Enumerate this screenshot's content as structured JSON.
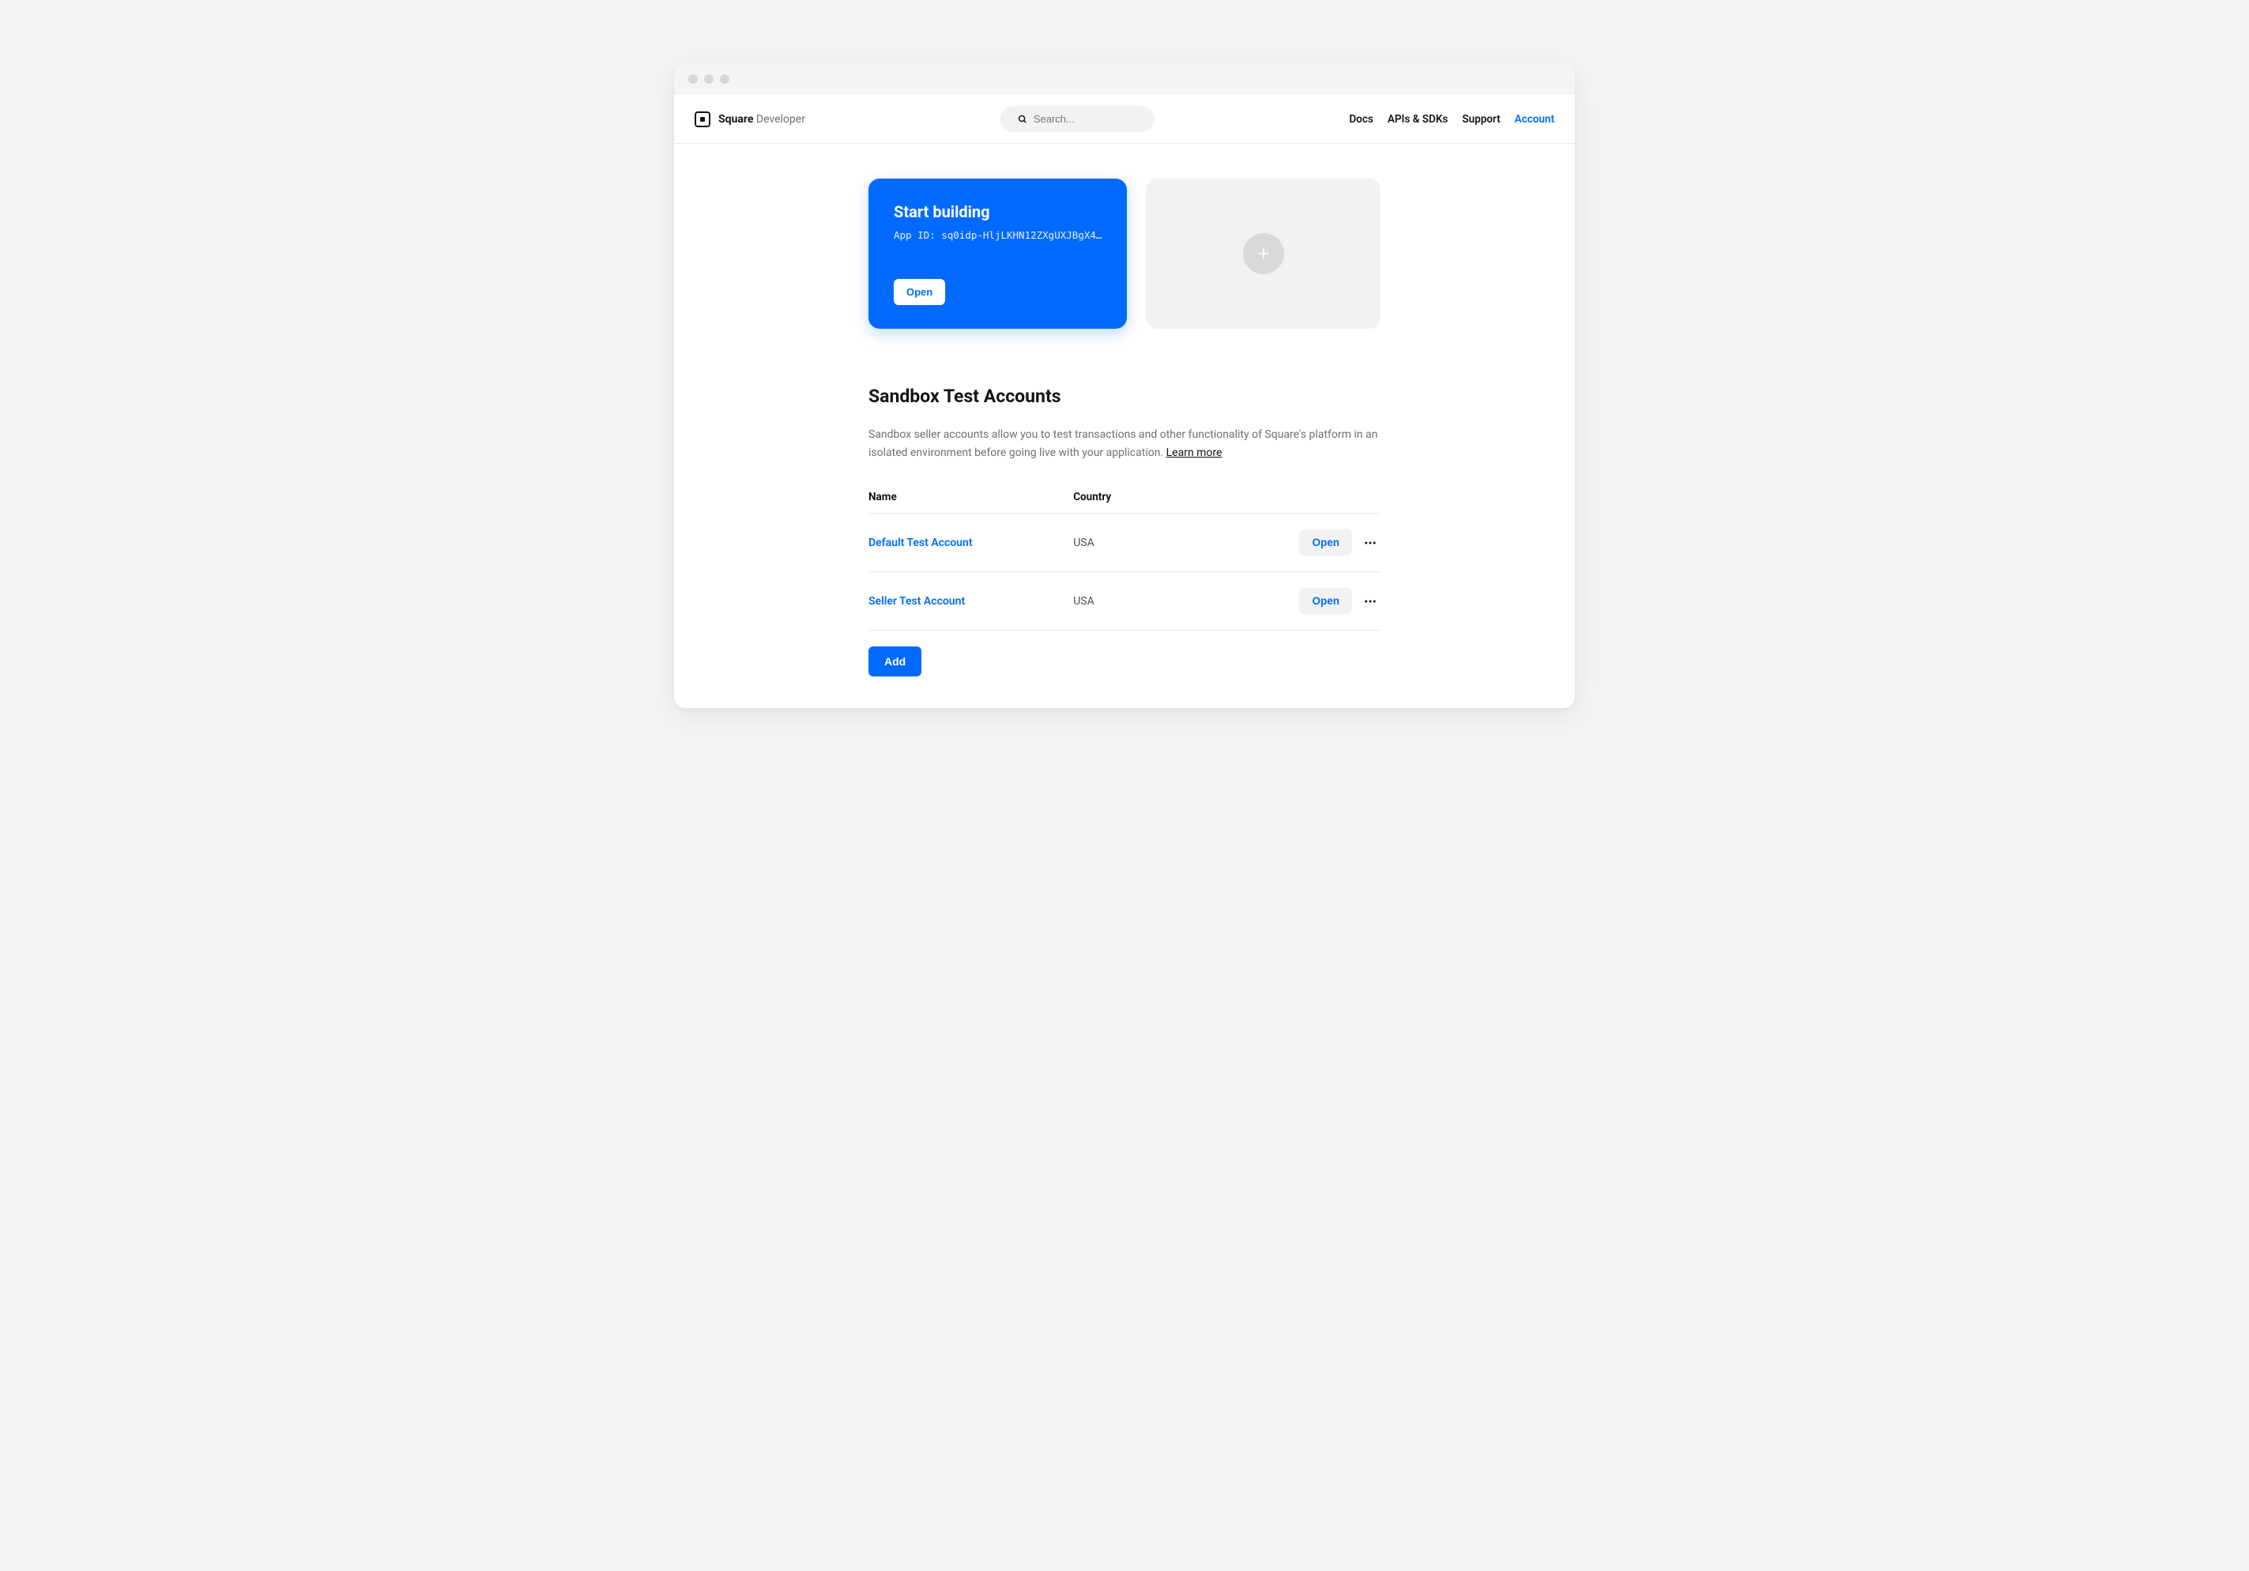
{
  "header": {
    "brand": "Square",
    "brand_sub": "Developer",
    "search_placeholder": "Search...",
    "nav": [
      {
        "label": "Docs",
        "active": false
      },
      {
        "label": "APIs & SDKs",
        "active": false
      },
      {
        "label": "Support",
        "active": false
      },
      {
        "label": "Account",
        "active": true
      }
    ]
  },
  "cards": {
    "primary": {
      "title": "Start building",
      "app_id_label": "App ID:",
      "app_id": "sq0idp-HljLKHN12ZXgUXJBgX4…",
      "open_label": "Open"
    }
  },
  "sandbox": {
    "title": "Sandbox Test Accounts",
    "description": "Sandbox seller accounts allow you to test transactions and other functionality of Square's platform in an isolated environment before going live with your application.",
    "learn_more": "Learn more",
    "columns": {
      "name": "Name",
      "country": "Country"
    },
    "accounts": [
      {
        "name": "Default Test Account",
        "country": "USA",
        "open_label": "Open"
      },
      {
        "name": "Seller Test Account",
        "country": "USA",
        "open_label": "Open"
      }
    ],
    "add_label": "Add"
  }
}
